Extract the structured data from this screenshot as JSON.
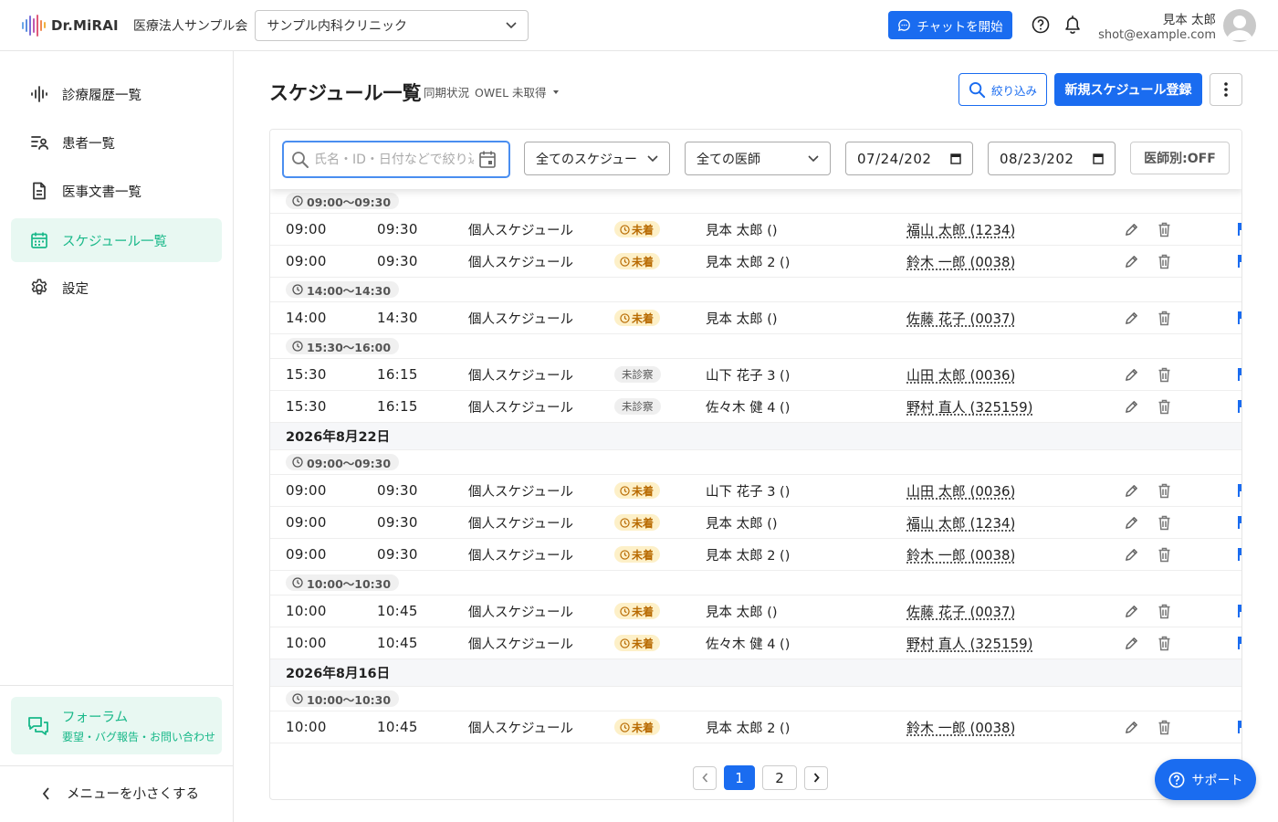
{
  "header": {
    "logo_text": "Dr.MiRAI",
    "org_name": "医療法人サンプル会",
    "clinic": "サンプル内科クリニック",
    "chat_label": "チャットを開始",
    "user_name": "見本 太郎",
    "user_email": "shot@example.com"
  },
  "sidebar": {
    "items": [
      {
        "label": "診療履歴一覧",
        "icon": "waveform-icon",
        "active": false
      },
      {
        "label": "患者一覧",
        "icon": "patient-list-icon",
        "active": false
      },
      {
        "label": "医事文書一覧",
        "icon": "document-icon",
        "active": false
      },
      {
        "label": "スケジュール一覧",
        "icon": "calendar-icon",
        "active": true
      },
      {
        "label": "設定",
        "icon": "gear-icon",
        "active": false
      }
    ],
    "forum_title": "フォーラム",
    "forum_sub": "要望・バグ報告・お問い合わせ",
    "collapse_label": "メニューを小さくする"
  },
  "main": {
    "title": "スケジュール一覧",
    "sync_label": "同期状況",
    "sync_value": "OWEL 未取得",
    "filter_label": "絞り込み",
    "new_label": "新規スケジュール登録"
  },
  "filters": {
    "search_placeholder": "氏名・ID・日付などで絞り込み",
    "schedule_select": "全てのスケジュー",
    "doctor_select": "全ての医師",
    "date_from": "07/24/202",
    "date_to": "08/23/202",
    "doctor_toggle": "医師別:OFF"
  },
  "schedule": [
    {
      "kind": "slot",
      "label": "09:00〜09:30"
    },
    {
      "kind": "row",
      "start": "09:00",
      "end": "09:30",
      "type": "個人スケジュール",
      "status": "未着",
      "status_kind": "unarrived",
      "doctor": "見本 太郎 ()",
      "patient": "福山 太郎 (1234)"
    },
    {
      "kind": "row",
      "start": "09:00",
      "end": "09:30",
      "type": "個人スケジュール",
      "status": "未着",
      "status_kind": "unarrived",
      "doctor": "見本 太郎 2 ()",
      "patient": "鈴木 一郎 (0038)"
    },
    {
      "kind": "slot",
      "label": "14:00〜14:30"
    },
    {
      "kind": "row",
      "start": "14:00",
      "end": "14:30",
      "type": "個人スケジュール",
      "status": "未着",
      "status_kind": "unarrived",
      "doctor": "見本 太郎 ()",
      "patient": "佐藤 花子 (0037)"
    },
    {
      "kind": "slot",
      "label": "15:30〜16:00"
    },
    {
      "kind": "row",
      "start": "15:30",
      "end": "16:15",
      "type": "個人スケジュール",
      "status": "未診察",
      "status_kind": "unexamined",
      "doctor": "山下 花子 3 ()",
      "patient": "山田 太郎 (0036)"
    },
    {
      "kind": "row",
      "start": "15:30",
      "end": "16:15",
      "type": "個人スケジュール",
      "status": "未診察",
      "status_kind": "unexamined",
      "doctor": "佐々木 健 4 ()",
      "patient": "野村 直人 (325159)"
    },
    {
      "kind": "date",
      "label": "2026年8月22日"
    },
    {
      "kind": "slot",
      "label": "09:00〜09:30"
    },
    {
      "kind": "row",
      "start": "09:00",
      "end": "09:30",
      "type": "個人スケジュール",
      "status": "未着",
      "status_kind": "unarrived",
      "doctor": "山下 花子 3 ()",
      "patient": "山田 太郎 (0036)"
    },
    {
      "kind": "row",
      "start": "09:00",
      "end": "09:30",
      "type": "個人スケジュール",
      "status": "未着",
      "status_kind": "unarrived",
      "doctor": "見本 太郎 ()",
      "patient": "福山 太郎 (1234)"
    },
    {
      "kind": "row",
      "start": "09:00",
      "end": "09:30",
      "type": "個人スケジュール",
      "status": "未着",
      "status_kind": "unarrived",
      "doctor": "見本 太郎 2 ()",
      "patient": "鈴木 一郎 (0038)"
    },
    {
      "kind": "slot",
      "label": "10:00〜10:30"
    },
    {
      "kind": "row",
      "start": "10:00",
      "end": "10:45",
      "type": "個人スケジュール",
      "status": "未着",
      "status_kind": "unarrived",
      "doctor": "見本 太郎 ()",
      "patient": "佐藤 花子 (0037)"
    },
    {
      "kind": "row",
      "start": "10:00",
      "end": "10:45",
      "type": "個人スケジュール",
      "status": "未着",
      "status_kind": "unarrived",
      "doctor": "佐々木 健 4 ()",
      "patient": "野村 直人 (325159)"
    },
    {
      "kind": "date",
      "label": "2026年8月16日"
    },
    {
      "kind": "slot",
      "label": "10:00〜10:30"
    },
    {
      "kind": "row",
      "start": "10:00",
      "end": "10:45",
      "type": "個人スケジュール",
      "status": "未着",
      "status_kind": "unarrived",
      "doctor": "見本 太郎 2 ()",
      "patient": "鈴木 一郎 (0038)"
    }
  ],
  "pagination": {
    "pages": [
      "1",
      "2"
    ],
    "current": "1"
  },
  "support_label": "サポート",
  "colors": {
    "primary": "#1a6cf0",
    "accent_green": "#18b889",
    "badge_amber": "#b86a00"
  }
}
